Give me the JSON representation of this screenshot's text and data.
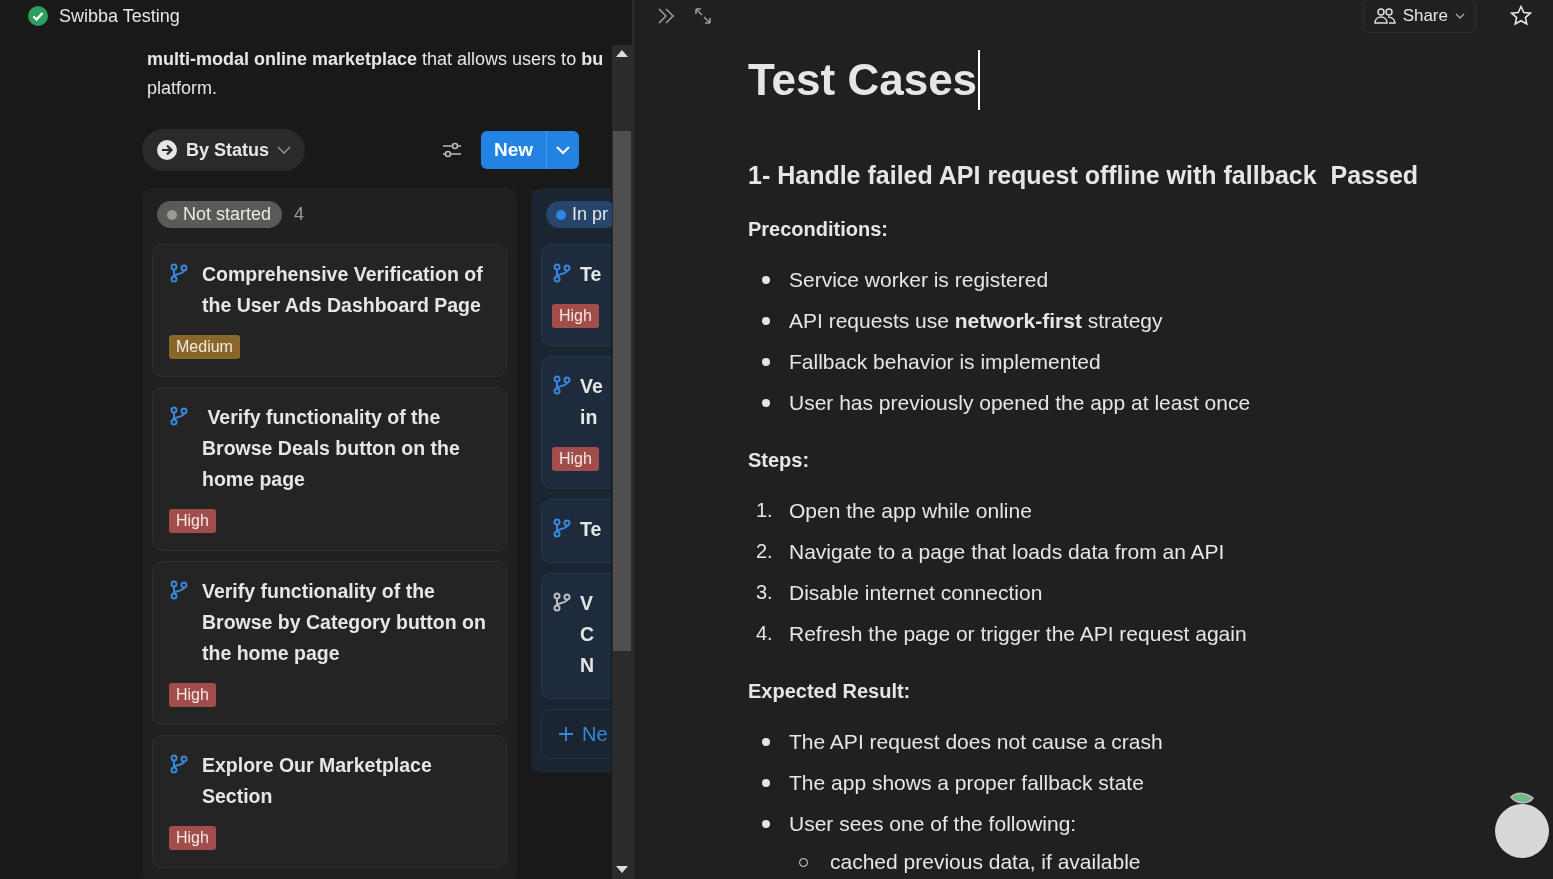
{
  "workspace": {
    "title": "Swibba Testing"
  },
  "description_lines": [
    "**multi-modal online marketplace** that allows users to **bu**",
    "platform."
  ],
  "board": {
    "group_by": "By Status",
    "new_button": "New",
    "columns": [
      {
        "kind": "gray",
        "status": {
          "label": "Not started",
          "color": "#9b9a97"
        },
        "count": "4",
        "cards": [
          {
            "title": "Comprehensive Verification of the User Ads Dashboard Page",
            "muted": false,
            "priority": {
              "label": "Medium",
              "color": "#89672b"
            }
          },
          {
            "title": " Verify functionality of the Browse Deals button on the home page",
            "muted": false,
            "priority": {
              "label": "High",
              "color": "#a24d4b"
            }
          },
          {
            "title": "Verify functionality of the Browse by Category button on the home page",
            "muted": false,
            "priority": {
              "label": "High",
              "color": "#a24d4b"
            }
          },
          {
            "title": "Explore Our Marketplace Section",
            "muted": false,
            "priority": {
              "label": "High",
              "color": "#a24d4b"
            }
          }
        ]
      },
      {
        "kind": "blue",
        "status": {
          "label": "In pr",
          "color": "#2e87e6"
        },
        "add_label": "Ne",
        "cards": [
          {
            "title": "Te",
            "muted": false,
            "priority": {
              "label": "High",
              "color": "#a24d4b"
            }
          },
          {
            "title": "Ve in",
            "muted": false,
            "priority": {
              "label": "High",
              "color": "#a24d4b"
            }
          },
          {
            "title": "Te",
            "muted": false
          },
          {
            "title": "V C N",
            "muted": true
          }
        ]
      }
    ]
  },
  "toolbar": {
    "share": "Share"
  },
  "doc": {
    "title": "Test Cases",
    "heading": "1- Handle failed API request offline with fallback  Passed",
    "blocks": [
      {
        "kind": "label",
        "text": "Preconditions:"
      },
      {
        "kind": "bullets",
        "items": [
          {
            "text": "Service worker is registered"
          },
          {
            "text": "API requests use **network-first** strategy"
          },
          {
            "text": "Fallback behavior is implemented"
          },
          {
            "text": "User has previously opened the app at least once"
          }
        ]
      },
      {
        "kind": "label",
        "text": "Steps:"
      },
      {
        "kind": "numbered",
        "items": [
          {
            "marker": "1.",
            "text": "Open the app while online"
          },
          {
            "marker": "2.",
            "text": "Navigate to a page that loads data from an API"
          },
          {
            "marker": "3.",
            "text": "Disable internet connection"
          },
          {
            "marker": "4.",
            "text": "Refresh the page or trigger the API request again"
          }
        ]
      },
      {
        "kind": "label",
        "text": "Expected Result:"
      },
      {
        "kind": "bullets",
        "items": [
          {
            "text": "The API request does not cause a crash"
          },
          {
            "text": "The app shows a proper fallback state"
          },
          {
            "text": "User sees one of the following:",
            "children": [
              {
                "text": "cached previous data, if available"
              }
            ]
          }
        ]
      }
    ]
  }
}
